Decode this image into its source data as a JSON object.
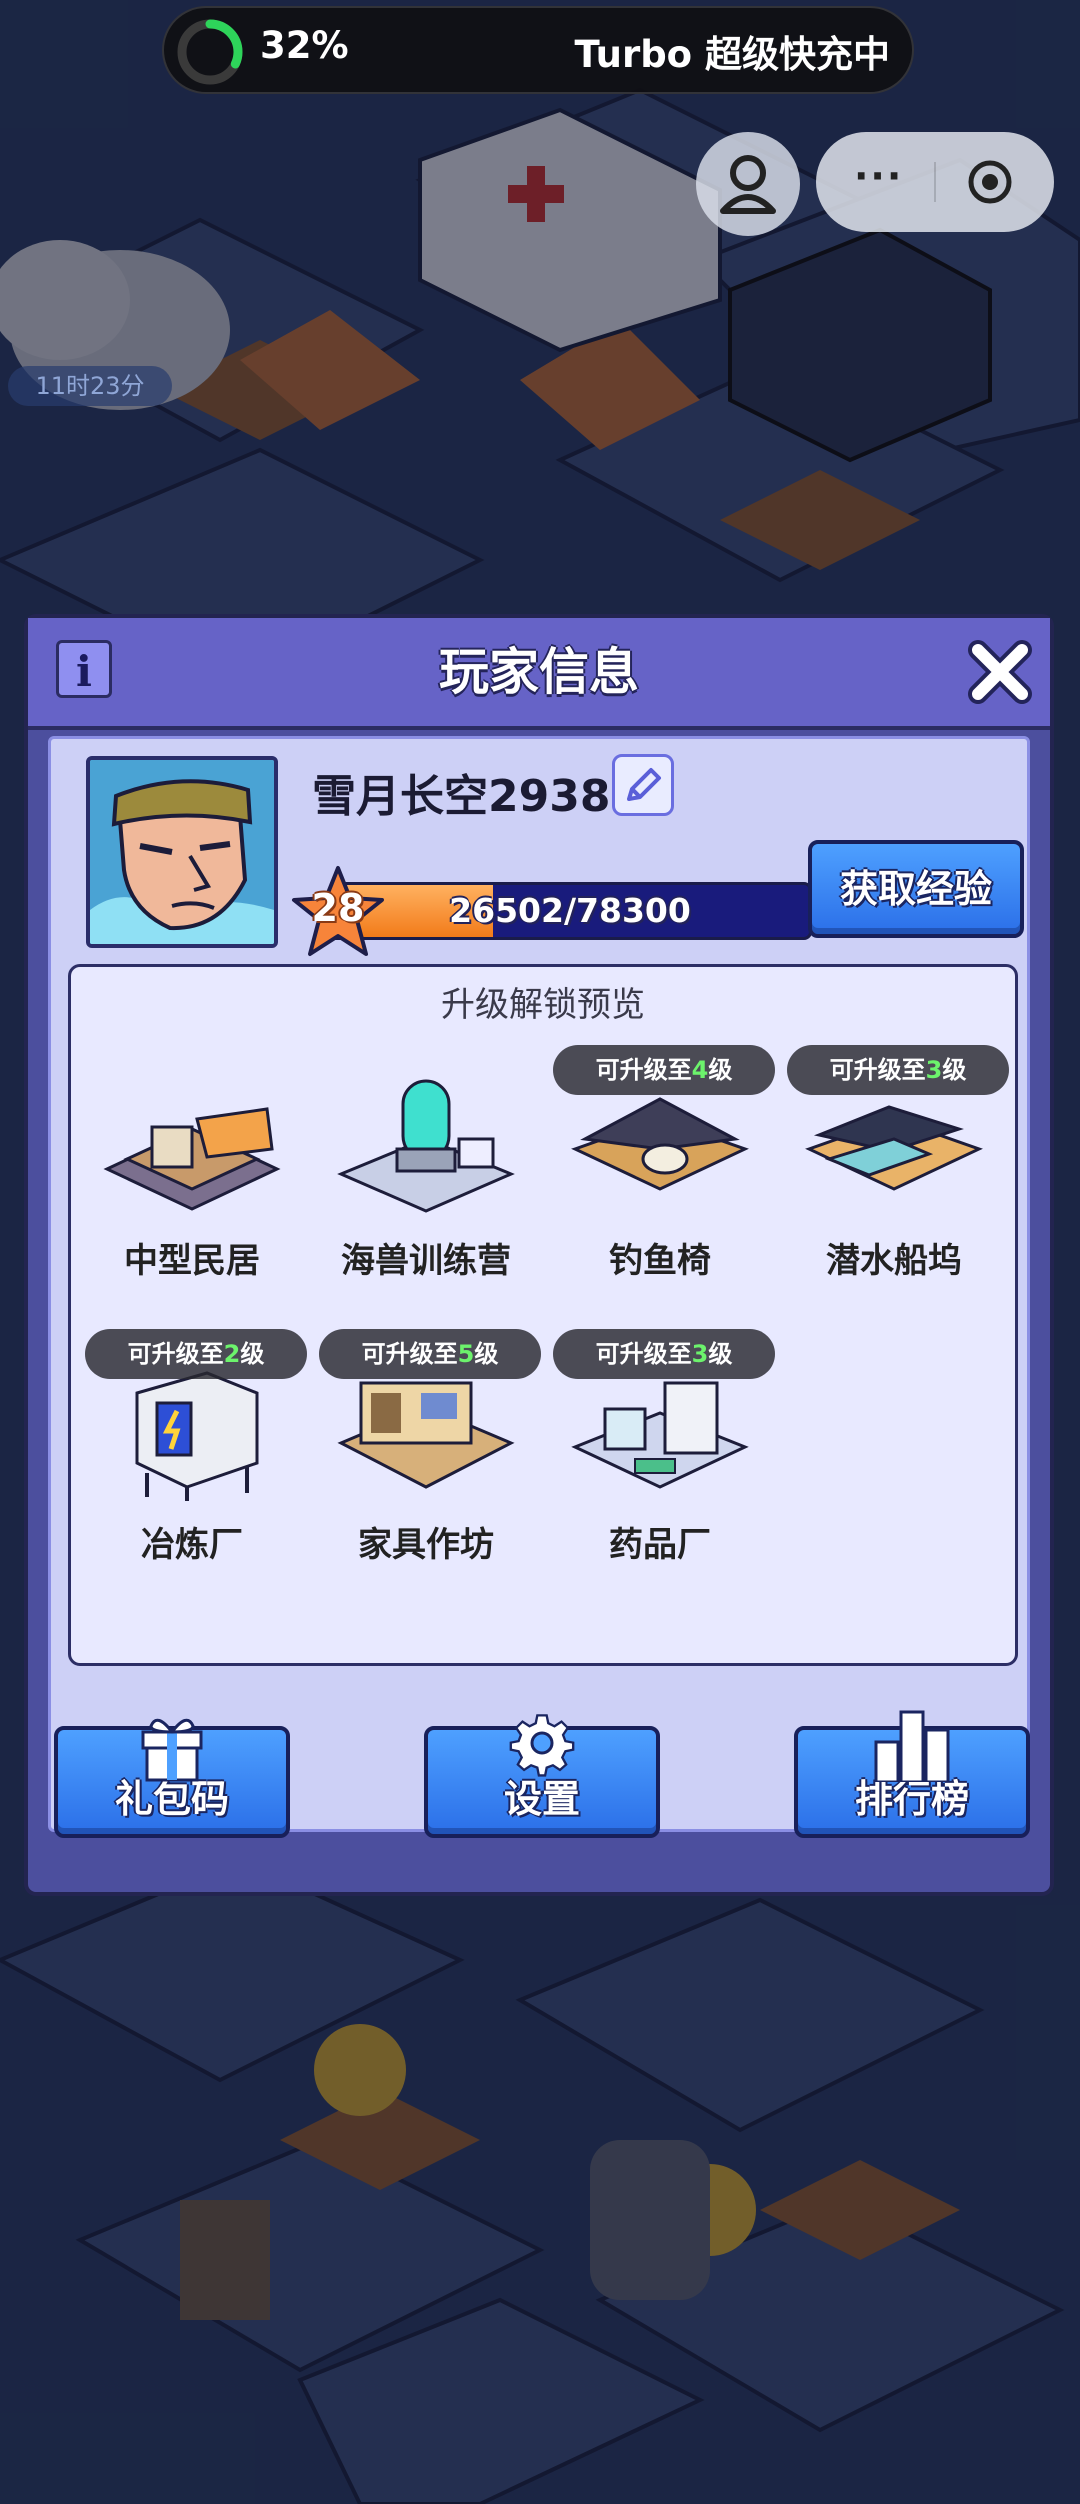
{
  "status_bar": {
    "progress_percent": 32,
    "progress_label": "32%",
    "mode_label": "Turbo 超级快充中"
  },
  "hud": {
    "timer": "11时23分",
    "menu_dots": "···"
  },
  "dialog": {
    "title": "玩家信息",
    "player_name": "雪月长空2938",
    "level": "28",
    "xp_text": "26502/78300",
    "xp_current": 26502,
    "xp_max": 78300,
    "get_exp_label": "获取经验",
    "preview_title": "升级解锁预览",
    "buildings": [
      {
        "name": "中型民居",
        "badge": null
      },
      {
        "name": "海兽训练营",
        "badge": null
      },
      {
        "name": "钓鱼椅",
        "badge": {
          "prefix": "可升级至",
          "num": "4",
          "suffix": "级"
        }
      },
      {
        "name": "潜水船坞",
        "badge": {
          "prefix": "可升级至",
          "num": "3",
          "suffix": "级"
        }
      },
      {
        "name": "冶炼厂",
        "badge": {
          "prefix": "可升级至",
          "num": "2",
          "suffix": "级"
        }
      },
      {
        "name": "家具作坊",
        "badge": {
          "prefix": "可升级至",
          "num": "5",
          "suffix": "级"
        }
      },
      {
        "name": "药品厂",
        "badge": {
          "prefix": "可升级至",
          "num": "3",
          "suffix": "级"
        }
      }
    ],
    "buttons": {
      "gift_code": "礼包码",
      "settings": "设置",
      "leaderboard": "排行榜"
    }
  },
  "colors": {
    "panel": "#4c4f9e",
    "header": "#6663c7",
    "inner": "#cdd0f6",
    "button_blue": "#3b86f6",
    "xp_orange": "#f27b1a",
    "level_up_green": "#6cf36c"
  }
}
